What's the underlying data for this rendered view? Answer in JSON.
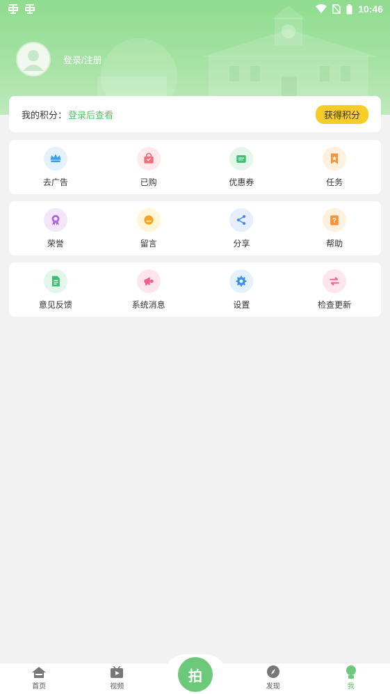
{
  "status_bar": {
    "time": "10:46",
    "left_icons": [
      "app-notification-icon",
      "app-notification-icon"
    ],
    "right_icons": [
      "wifi-icon",
      "no-sim-icon",
      "battery-icon"
    ]
  },
  "profile": {
    "login_text": "登录/注册"
  },
  "points": {
    "label": "我的积分：",
    "status": "登录后查看",
    "button": "获得积分"
  },
  "menu_rows": [
    [
      {
        "label": "去广告",
        "icon": "crown-icon",
        "bg": "#e4f2ff",
        "fg": "#3aa0f0"
      },
      {
        "label": "已购",
        "icon": "shopping-bag-icon",
        "bg": "#ffe9ec",
        "fg": "#f06d7a"
      },
      {
        "label": "优惠券",
        "icon": "coupon-icon",
        "bg": "#e3f7ea",
        "fg": "#3cc070"
      },
      {
        "label": "任务",
        "icon": "task-bookmark-icon",
        "bg": "#fff0e0",
        "fg": "#f5923a"
      }
    ],
    [
      {
        "label": "荣誉",
        "icon": "medal-icon",
        "bg": "#f3e6fb",
        "fg": "#b265e6"
      },
      {
        "label": "留言",
        "icon": "message-icon",
        "bg": "#fff6d8",
        "fg": "#f5a623"
      },
      {
        "label": "分享",
        "icon": "share-icon",
        "bg": "#e6efff",
        "fg": "#4f86f0"
      },
      {
        "label": "帮助",
        "icon": "help-icon",
        "bg": "#fff0e0",
        "fg": "#f5923a"
      }
    ],
    [
      {
        "label": "意见反馈",
        "icon": "feedback-doc-icon",
        "bg": "#e3f7ea",
        "fg": "#3cc070"
      },
      {
        "label": "系统消息",
        "icon": "megaphone-icon",
        "bg": "#ffe6ee",
        "fg": "#f0608a"
      },
      {
        "label": "设置",
        "icon": "gear-icon",
        "bg": "#e4f2ff",
        "fg": "#3a8ff0"
      },
      {
        "label": "检查更新",
        "icon": "update-arrows-icon",
        "bg": "#ffe6ee",
        "fg": "#f0608a"
      }
    ]
  ],
  "bottom_nav": {
    "items": [
      {
        "label": "首页",
        "icon": "home-icon"
      },
      {
        "label": "视频",
        "icon": "video-icon"
      },
      {
        "label": "发现",
        "icon": "compass-icon"
      },
      {
        "label": "我",
        "icon": "profile-icon"
      }
    ],
    "center_label": "拍"
  },
  "colors": {
    "accent": "#5cc06a",
    "header": "#8fdc8f",
    "button_yellow": "#f5cc2a"
  }
}
